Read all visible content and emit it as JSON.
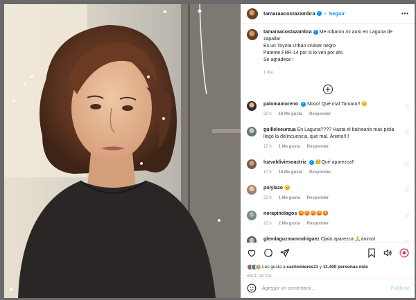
{
  "header": {
    "username": "tamaraacostazambra",
    "separator": "•",
    "follow_label": "Seguir",
    "more_label": "•••"
  },
  "caption": {
    "username": "tamaraacostazambra",
    "line1": "Me robaron mi auto en Laguna de zapallar",
    "line2": "Es un Toyota Urban cruiser negro",
    "line3": "Patente FRR-14 por si lo ven por ahí.",
    "line4": "Se agradece !",
    "time": "1 día"
  },
  "comments": [
    {
      "username": "palomamoreno",
      "verified": true,
      "text": "Nooo! Qué mal Tamara!! 😔",
      "time": "22 h",
      "likes": "16 Me gusta",
      "reply": "Responder"
    },
    {
      "username": "guilleleeurzua",
      "verified": false,
      "text": "En Laguna???? Hasta el balneario más piola llegó la delincuencia, qué mal. Ánimo!!!!",
      "time": "17 h",
      "likes": "1 Me gusta",
      "reply": "Responder"
    },
    {
      "username": "luzvaldiviesoactriz",
      "verified": true,
      "text": "😥Qué aparezca!!",
      "time": "17 h",
      "likes": "16 Me gusta",
      "reply": "Responder"
    },
    {
      "username": "polylazo",
      "verified": false,
      "text": "😠",
      "time": "22 h",
      "likes": "1 Me gusta",
      "reply": "Responder"
    },
    {
      "username": "norapinolagos",
      "verified": false,
      "text": "😡😡😡😡😡",
      "time": "22 h",
      "likes": "2 Me gusta",
      "reply": "Responder"
    },
    {
      "username": "glendaguzmanrodriguez",
      "verified": false,
      "text": "Ojalá aparezca 🙏ánimo!",
      "time": "",
      "likes": "",
      "reply": ""
    }
  ],
  "likes": {
    "prefix": "Les gusta a",
    "user": "caritomieres11",
    "middle": "y",
    "others": "11.400 personas más"
  },
  "post_date": "HACE UN DÍA",
  "add_comment": {
    "placeholder": "Agregar un comentario...",
    "publish_label": "Publicar"
  },
  "icons": [
    "heart-icon",
    "comment-icon",
    "share-icon",
    "bookmark-icon",
    "volume-icon",
    "reels-icon",
    "emoji-icon",
    "plus-circle-icon",
    "verified-icon"
  ],
  "colors": {
    "link": "#0095f6",
    "publish_disabled": "#b2dffc",
    "muted": "#8e8e8e"
  }
}
